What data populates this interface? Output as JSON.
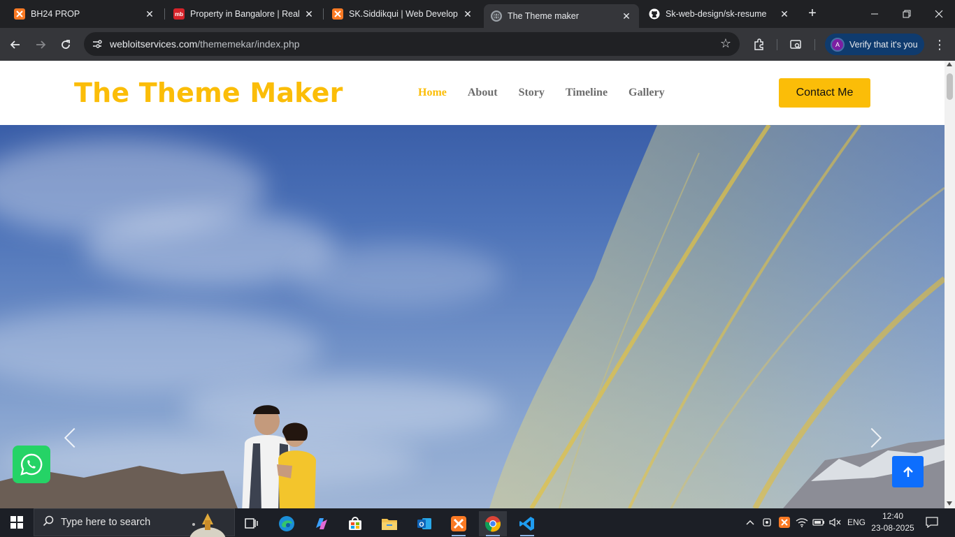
{
  "browser": {
    "tabs": [
      {
        "title": "BH24 PROP",
        "favicon": "xampp-icon",
        "color": "#fb7a24"
      },
      {
        "title": "Property in Bangalore | Real E",
        "favicon": "magicbricks-icon",
        "color": "#d8232a",
        "badge": "mb"
      },
      {
        "title": "SK.Siddikqui | Web Developer",
        "favicon": "xampp-icon",
        "color": "#fb7a24"
      },
      {
        "title": "The Theme maker",
        "favicon": "globe-icon",
        "color": "#9aa0a6",
        "active": true
      },
      {
        "title": "Sk-web-design/sk-resume",
        "favicon": "github-icon",
        "color": "#ffffff"
      }
    ],
    "url_host": "webloitservices.com",
    "url_path": "/thememekar/index.php",
    "profile_initial": "A",
    "profile_label": "Verify that it's you"
  },
  "site": {
    "brand": "The Theme Maker",
    "nav": [
      "Home",
      "About",
      "Story",
      "Timeline",
      "Gallery"
    ],
    "active_nav": "Home",
    "contact_label": "Contact Me",
    "accent": "#fbbd08",
    "scroll_top_color": "#0d6efd",
    "whatsapp_color": "#25d366"
  },
  "taskbar": {
    "search_placeholder": "Type here to search",
    "language": "ENG",
    "time": "12:40",
    "date": "23-08-2025",
    "apps": [
      "task-view-icon",
      "edge-icon",
      "copilot-icon",
      "store-icon",
      "file-explorer-icon",
      "outlook-icon",
      "xampp-icon",
      "chrome-icon",
      "vscode-icon"
    ]
  }
}
